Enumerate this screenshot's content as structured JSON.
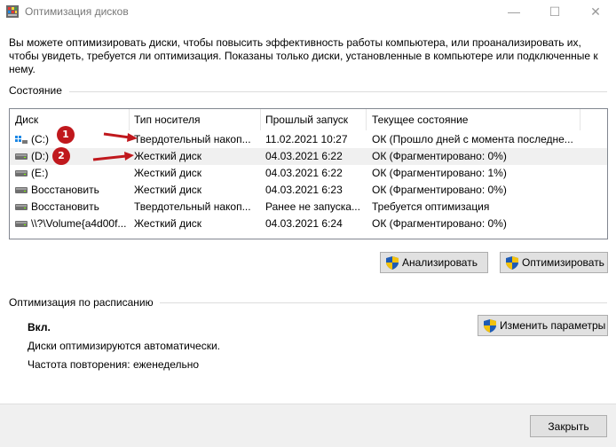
{
  "window": {
    "title": "Оптимизация дисков",
    "minimize_glyph": "—",
    "maximize_glyph": "☐",
    "close_glyph": "✕"
  },
  "description": "Вы можете оптимизировать диски, чтобы повысить эффективность работы  компьютера, или проанализировать их, чтобы увидеть, требуется ли оптимизация. Показаны только диски, установленные в компьютере или подключенные к нему.",
  "status_section": {
    "label": "Состояние",
    "columns": [
      "Диск",
      "Тип носителя",
      "Прошлый запуск",
      "Текущее состояние"
    ],
    "rows": [
      {
        "disk": "(C:)",
        "icon": "windows-drive-icon",
        "media": "Твердотельный накоп...",
        "last_run": "11.02.2021 10:27",
        "status": "ОК (Прошло дней с момента последне..."
      },
      {
        "disk": "(D:)",
        "icon": "hard-drive-icon",
        "media": "Жесткий диск",
        "last_run": "04.03.2021 6:22",
        "status": "ОК (Фрагментировано: 0%)"
      },
      {
        "disk": "(E:)",
        "icon": "hard-drive-icon",
        "media": "Жесткий диск",
        "last_run": "04.03.2021 6:22",
        "status": "ОК (Фрагментировано: 1%)"
      },
      {
        "disk": "Восстановить",
        "icon": "hard-drive-icon",
        "media": "Жесткий диск",
        "last_run": "04.03.2021 6:23",
        "status": "ОК (Фрагментировано: 0%)"
      },
      {
        "disk": "Восстановить",
        "icon": "hard-drive-icon",
        "media": "Твердотельный накоп...",
        "last_run": "Ранее не запуска...",
        "status": "Требуется оптимизация"
      },
      {
        "disk": "\\\\?\\Volume{a4d00f...",
        "icon": "hard-drive-icon",
        "media": "Жесткий диск",
        "last_run": "04.03.2021 6:24",
        "status": "ОК (Фрагментировано: 0%)"
      }
    ],
    "selected_row": 1,
    "analyze_label": "Анализировать",
    "optimize_label": "Оптимизировать"
  },
  "schedule_section": {
    "label": "Оптимизация по расписанию",
    "state": "Вкл.",
    "line1": "Диски оптимизируются автоматически.",
    "line2": "Частота повторения: еженедельно",
    "change_label": "Изменить параметры"
  },
  "footer": {
    "close_label": "Закрыть"
  },
  "annotations": {
    "badge1": "1",
    "badge2": "2",
    "color": "#c0181d"
  },
  "colors": {
    "selected_row": "#f0f0f0",
    "button_face": "#e1e1e1",
    "footer": "#f0f0f0"
  }
}
